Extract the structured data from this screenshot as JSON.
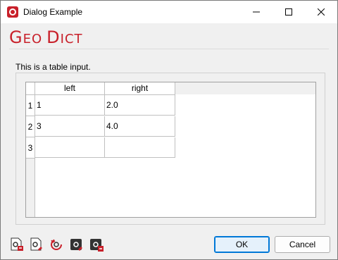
{
  "window": {
    "title": "Dialog Example"
  },
  "logo": {
    "part1_cap": "G",
    "part1_rest": "EO",
    "part2_cap": "D",
    "part2_rest": "ICT"
  },
  "description": "This is a table input.",
  "table": {
    "columns": [
      "left",
      "right"
    ],
    "rows": [
      {
        "header": "1",
        "cells": [
          "1",
          "2.0"
        ]
      },
      {
        "header": "2",
        "cells": [
          "3",
          "4.0"
        ]
      },
      {
        "header": "3",
        "cells": [
          "",
          ""
        ]
      }
    ]
  },
  "buttons": {
    "ok": "OK",
    "cancel": "Cancel"
  },
  "toolbar_icons": [
    "load-macro-icon",
    "save-macro-icon",
    "reset-icon",
    "settings-import-icon",
    "settings-export-icon"
  ],
  "colors": {
    "accent": "#c8202a",
    "focus": "#0078d7"
  }
}
